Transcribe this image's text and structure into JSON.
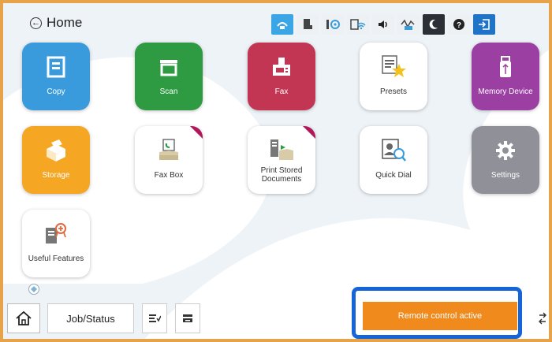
{
  "header": {
    "home_label": "Home",
    "status_icons": [
      "wifi-direct-icon",
      "printer-ink-icon",
      "battery-info-icon",
      "wifi-icon",
      "speaker-icon",
      "wired-lan-icon",
      "sleep-icon",
      "help-icon",
      "login-icon"
    ]
  },
  "tiles": [
    {
      "label": "Copy",
      "color": "#3a9bdc",
      "icon": "copy-icon"
    },
    {
      "label": "Scan",
      "color": "#2e9b43",
      "icon": "scan-icon"
    },
    {
      "label": "Fax",
      "color": "#c23653",
      "icon": "fax-icon"
    },
    {
      "label": "Presets",
      "color": "#ffffff",
      "icon": "presets-icon"
    },
    {
      "label": "Memory Device",
      "color": "#9b3fa3",
      "icon": "memory-device-icon"
    },
    {
      "label": "Storage",
      "color": "#f5a623",
      "icon": "storage-icon"
    },
    {
      "label": "Fax Box",
      "color": "#ffffff",
      "icon": "fax-box-icon"
    },
    {
      "label": "Print Stored Documents",
      "label_line1": "Print Stored",
      "label_line2": "Documents",
      "color": "#ffffff",
      "icon": "print-stored-documents-icon"
    },
    {
      "label": "Quick Dial",
      "color": "#ffffff",
      "icon": "quick-dial-icon"
    },
    {
      "label": "Settings",
      "color": "#8f9098",
      "icon": "settings-icon"
    },
    {
      "label": "Useful Features",
      "color": "#ffffff",
      "icon": "useful-features-icon"
    }
  ],
  "bottom": {
    "job_status_label": "Job/Status",
    "remote_label": "Remote control active"
  },
  "colors": {
    "frame_border": "#e7a349",
    "remote_button": "#f08a1c",
    "highlight_outline": "#1565d8"
  }
}
